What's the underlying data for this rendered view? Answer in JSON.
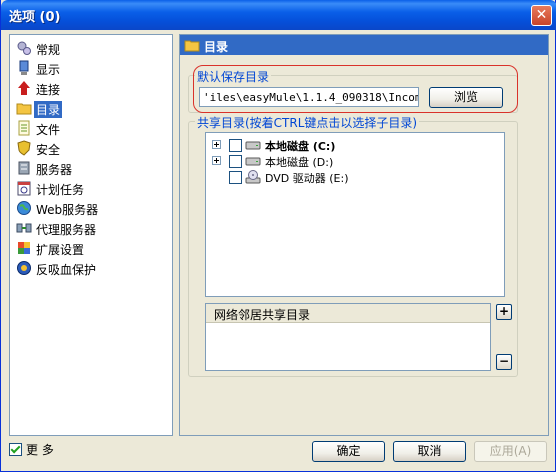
{
  "window": {
    "title": "选项 (0)"
  },
  "sidebar": {
    "items": [
      {
        "label": "常规",
        "icon": "gears-icon"
      },
      {
        "label": "显示",
        "icon": "display-icon"
      },
      {
        "label": "连接",
        "icon": "connection-icon"
      },
      {
        "label": "目录",
        "icon": "folder-icon",
        "selected": true
      },
      {
        "label": "文件",
        "icon": "file-icon"
      },
      {
        "label": "安全",
        "icon": "shield-icon"
      },
      {
        "label": "服务器",
        "icon": "server-icon"
      },
      {
        "label": "计划任务",
        "icon": "calendar-icon"
      },
      {
        "label": "Web服务器",
        "icon": "globe-icon"
      },
      {
        "label": "代理服务器",
        "icon": "proxy-icon"
      },
      {
        "label": "扩展设置",
        "icon": "extension-icon"
      },
      {
        "label": "反吸血保护",
        "icon": "protect-icon"
      }
    ],
    "more_label": "更 多",
    "more_checked": true
  },
  "panel": {
    "header": "目录",
    "save_group": {
      "legend": "默认保存目录",
      "path_value": "'iles\\easyMule\\1.1.4_090318\\Incoming",
      "browse_label": "浏览"
    },
    "share_group": {
      "legend": "共享目录(按着CTRL键点击以选择子目录)",
      "tree": [
        {
          "label": "本地磁盘 (C:)",
          "bold": true,
          "expandable": true
        },
        {
          "label": "本地磁盘 (D:)",
          "bold": false,
          "expandable": true
        },
        {
          "label": "DVD 驱动器 (E:)",
          "bold": false,
          "expandable": false
        }
      ],
      "network_header": "网络邻居共享目录",
      "add_label": "+",
      "remove_label": "−"
    }
  },
  "footer": {
    "ok": "确定",
    "cancel": "取消",
    "apply": "应用(A)"
  }
}
